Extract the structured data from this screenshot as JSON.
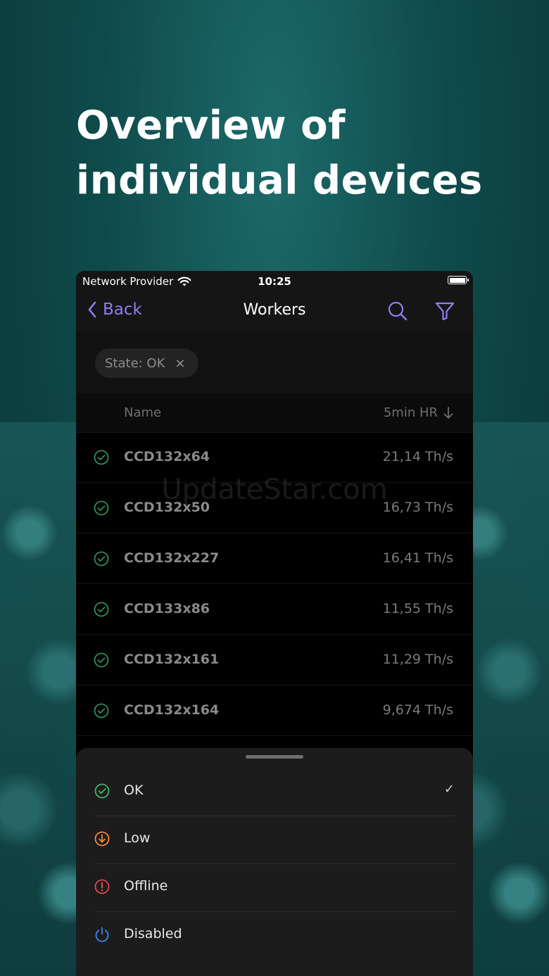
{
  "headline": "Overview of individual devices",
  "watermark": "UpdateStar.com",
  "status_bar": {
    "provider": "Network Provider",
    "time": "10:25"
  },
  "nav": {
    "back_label": "Back",
    "title": "Workers"
  },
  "filter_chip": {
    "label": "State: OK",
    "remove": "×"
  },
  "table": {
    "columns": {
      "name": "Name",
      "hashrate": "5min HR"
    },
    "rows": [
      {
        "name": "CCD132x64",
        "hashrate": "21,14 Th/s",
        "state": "ok"
      },
      {
        "name": "CCD132x50",
        "hashrate": "16,73 Th/s",
        "state": "ok"
      },
      {
        "name": "CCD132x227",
        "hashrate": "16,41 Th/s",
        "state": "ok"
      },
      {
        "name": "CCD133x86",
        "hashrate": "11,55 Th/s",
        "state": "ok"
      },
      {
        "name": "CCD132x161",
        "hashrate": "11,29 Th/s",
        "state": "ok"
      },
      {
        "name": "CCD132x164",
        "hashrate": "9,674 Th/s",
        "state": "ok"
      }
    ]
  },
  "state_sheet": {
    "options": [
      {
        "label": "OK",
        "icon": "check-circle-icon",
        "color": "#3fb56a",
        "selected": true,
        "check": "✓"
      },
      {
        "label": "Low",
        "icon": "arrow-down-circle-icon",
        "color": "#f08a3c",
        "selected": false
      },
      {
        "label": "Offline",
        "icon": "exclamation-circle-icon",
        "color": "#e5484d",
        "selected": false
      },
      {
        "label": "Disabled",
        "icon": "power-icon",
        "color": "#3d7fe0",
        "selected": false
      }
    ]
  },
  "colors": {
    "accent": "#8f7ef5",
    "ok_green": "#2f8f55"
  }
}
